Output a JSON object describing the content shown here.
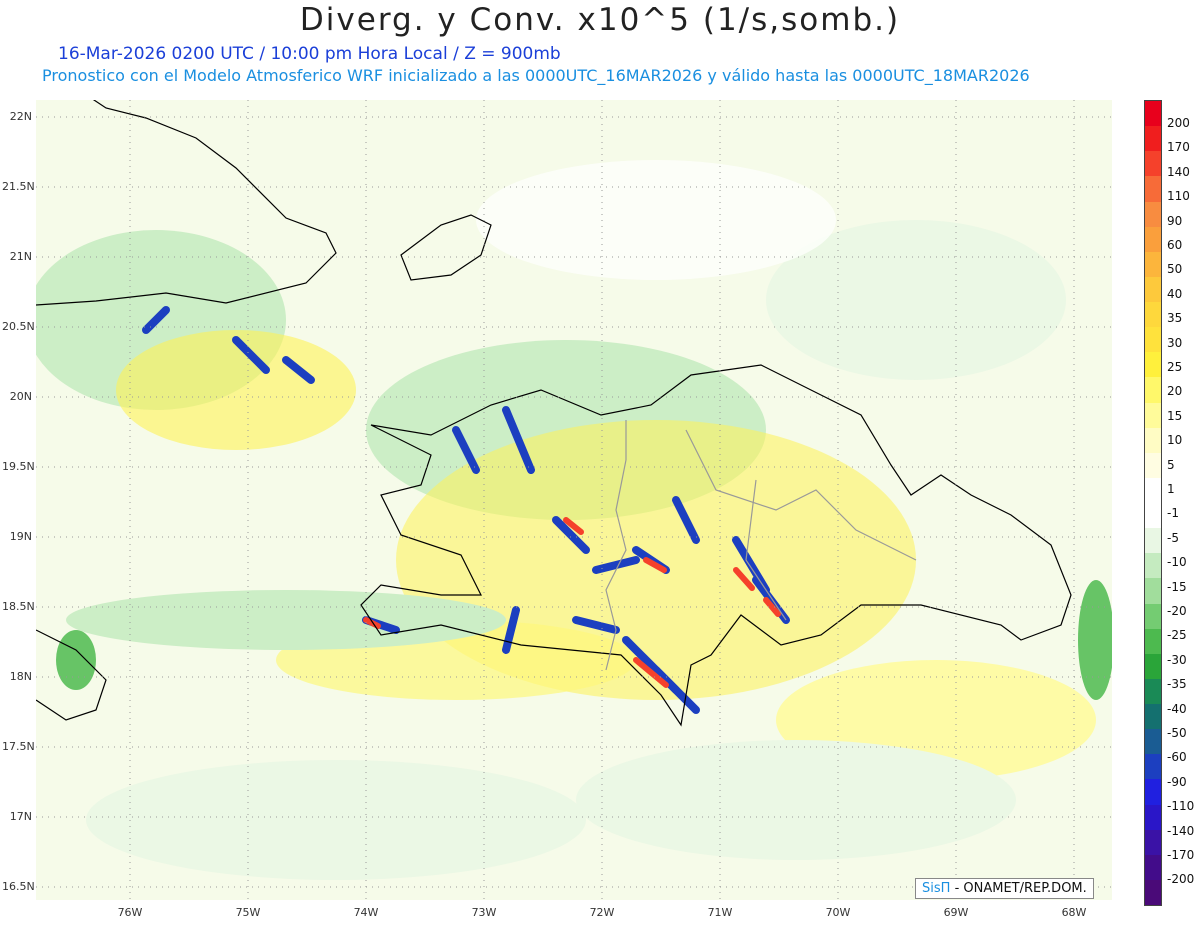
{
  "title": "Diverg. y Conv. x10^5 (1/s,somb.)",
  "subtitle_time": "16-Mar-2026  0200 UTC / 10:00 pm Hora Local / Z = 900mb",
  "subtitle_model": "Pronostico con el Modelo Atmosferico WRF inicializado a las 0000UTC_16MAR2026 y válido hasta las  0000UTC_18MAR2026",
  "credit": {
    "sis": "SisΠ",
    "org": "- ONAMET/REP.DOM."
  },
  "lat_labels": [
    "22N",
    "21.5N",
    "21N",
    "20.5N",
    "20N",
    "19.5N",
    "19N",
    "18.5N",
    "18N",
    "17.5N",
    "17N",
    "16.5N"
  ],
  "lon_labels": [
    "76W",
    "75W",
    "74W",
    "73W",
    "72W",
    "71W",
    "70W",
    "69W",
    "68W"
  ],
  "colorbar": {
    "labels": [
      "200",
      "170",
      "140",
      "110",
      "90",
      "60",
      "50",
      "40",
      "35",
      "30",
      "25",
      "20",
      "15",
      "10",
      "5",
      "1",
      "-1",
      "-5",
      "-10",
      "-15",
      "-20",
      "-25",
      "-30",
      "-35",
      "-40",
      "-50",
      "-60",
      "-90",
      "-110",
      "-140",
      "-170",
      "-200"
    ],
    "colors": [
      "#e8001c",
      "#f01e1e",
      "#f5412b",
      "#f76b38",
      "#f88c40",
      "#fa9f3c",
      "#fcb53c",
      "#fdc93c",
      "#fed83c",
      "#ffe23c",
      "#fff03c",
      "#fff86a",
      "#fffb9a",
      "#fffcc4",
      "#fffde2",
      "#ffffff",
      "#ffffff",
      "#e9f7e4",
      "#c5ebc0",
      "#a1dd9c",
      "#74cc72",
      "#4dba4f",
      "#2aa539",
      "#1a8a56",
      "#14706f",
      "#1a5c93",
      "#1c3fc0",
      "#2020e0",
      "#2a16c8",
      "#3a12a6",
      "#420c8a",
      "#4a0a78"
    ]
  }
}
